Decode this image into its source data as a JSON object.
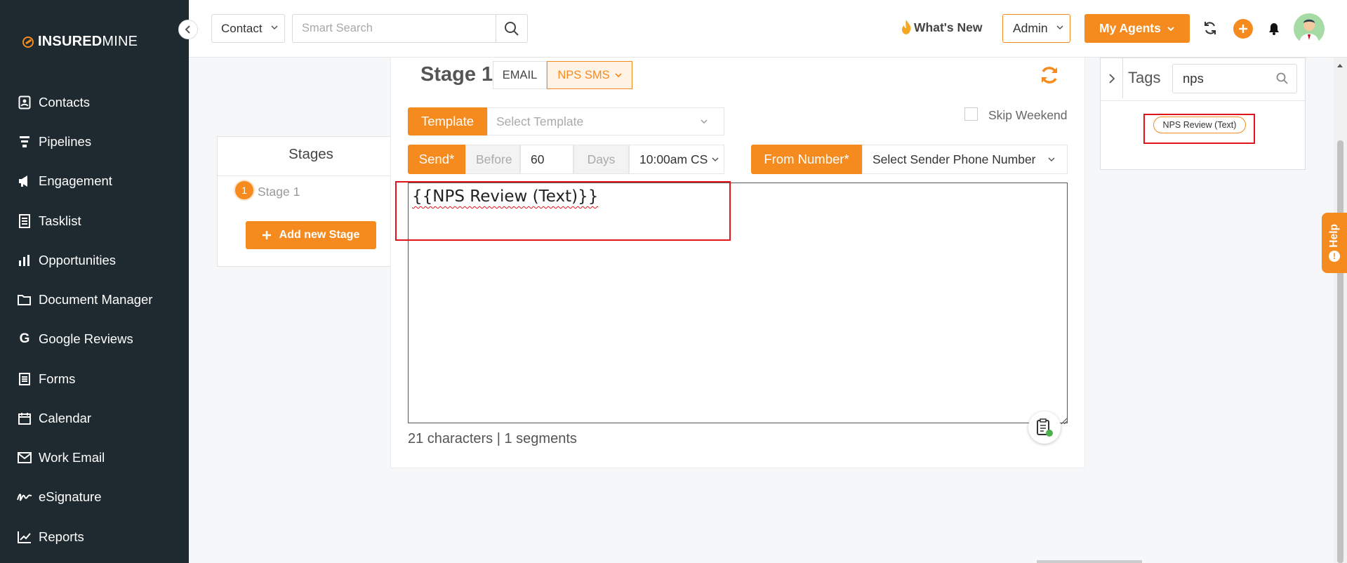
{
  "brand": {
    "name_bold": "INSURED",
    "name_light": "MINE",
    "accent": "#f58a1f",
    "sidebar_bg": "#1e2a2f"
  },
  "sidebar": {
    "items": [
      {
        "label": "Contacts",
        "icon": "contact-card-icon"
      },
      {
        "label": "Pipelines",
        "icon": "funnel-icon"
      },
      {
        "label": "Engagement",
        "icon": "megaphone-icon"
      },
      {
        "label": "Tasklist",
        "icon": "list-doc-icon"
      },
      {
        "label": "Opportunities",
        "icon": "bar-chart-icon"
      },
      {
        "label": "Document Manager",
        "icon": "folder-icon"
      },
      {
        "label": "Google Reviews",
        "icon": "google-g-icon"
      },
      {
        "label": "Forms",
        "icon": "form-icon"
      },
      {
        "label": "Calendar",
        "icon": "calendar-icon"
      },
      {
        "label": "Work Email",
        "icon": "envelope-icon"
      },
      {
        "label": "eSignature",
        "icon": "signature-icon"
      },
      {
        "label": "Reports",
        "icon": "line-chart-icon"
      }
    ]
  },
  "header": {
    "contact_select": "Contact",
    "search_placeholder": "Smart Search",
    "whats_new": "What's New",
    "admin_select": "Admin",
    "agents_label": "My Agents"
  },
  "stages": {
    "title": "Stages",
    "items": [
      {
        "number": "1",
        "label": "Stage 1"
      }
    ],
    "add_button": "Add new Stage"
  },
  "editor": {
    "heading": "Stage 1",
    "tabs": {
      "email": "EMAIL",
      "sms": "NPS SMS"
    },
    "template_label": "Template",
    "template_placeholder": "Select Template",
    "skip_weekend": "Skip Weekend",
    "send_label": "Send*",
    "before_label": "Before",
    "days_value": "60",
    "days_label": "Days",
    "time_value": "10:00am CS",
    "from_label": "From Number*",
    "sender_placeholder": "Select Sender Phone Number",
    "message": "{{NPS Review (Text)}}",
    "char_info": "21 characters | 1 segments"
  },
  "tags": {
    "title": "Tags",
    "search_value": "nps",
    "chips": [
      "NPS Review (Text)"
    ]
  },
  "help": {
    "label": "Help"
  }
}
